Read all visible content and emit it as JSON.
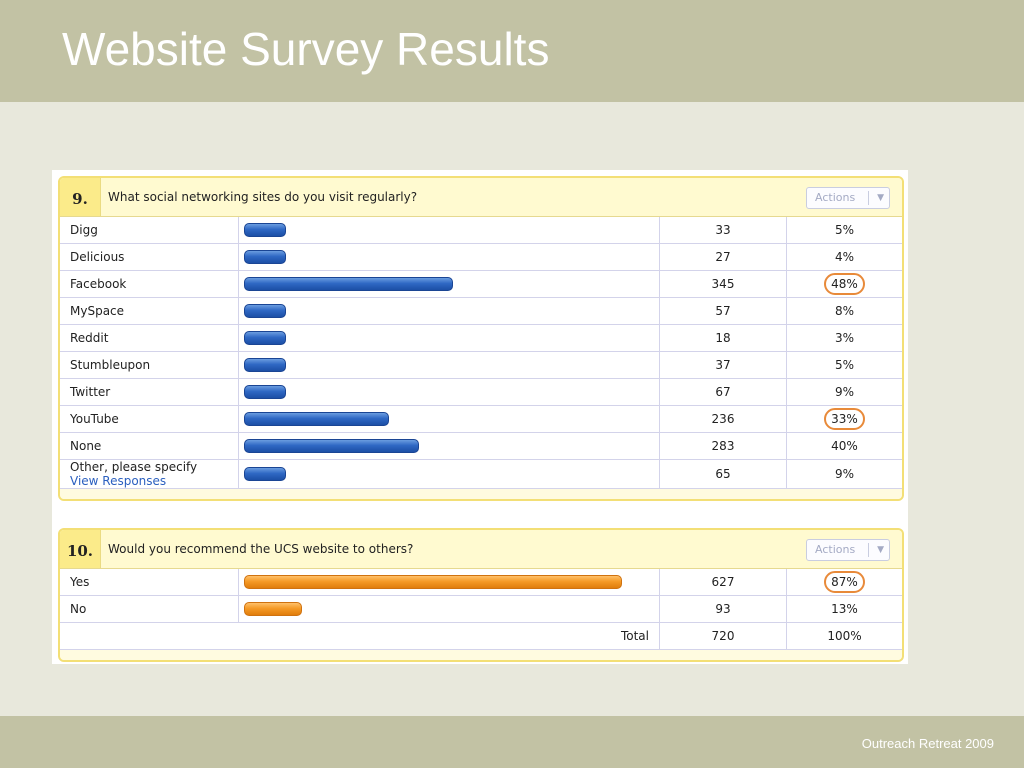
{
  "slide": {
    "title": "Website Survey Results",
    "footer": "Outreach Retreat 2009"
  },
  "colors": {
    "band": "#c2c2a4",
    "background": "#e8e8dc",
    "bar_blue": "#2f68c4",
    "bar_orange": "#f59a27",
    "highlight_circle": "#e88a3a"
  },
  "q9": {
    "number": "9.",
    "question": "What social networking sites do you visit regularly?",
    "actions_label": "Actions",
    "actions_icon": "chevron-down-icon",
    "rows": [
      {
        "label": "Digg",
        "count": "33",
        "percent": "5%",
        "fraction": 0.05,
        "highlighted": false
      },
      {
        "label": "Delicious",
        "count": "27",
        "percent": "4%",
        "fraction": 0.04,
        "highlighted": false
      },
      {
        "label": "Facebook",
        "count": "345",
        "percent": "48%",
        "fraction": 0.48,
        "highlighted": true
      },
      {
        "label": "MySpace",
        "count": "57",
        "percent": "8%",
        "fraction": 0.08,
        "highlighted": false
      },
      {
        "label": "Reddit",
        "count": "18",
        "percent": "3%",
        "fraction": 0.03,
        "highlighted": false
      },
      {
        "label": "Stumbleupon",
        "count": "37",
        "percent": "5%",
        "fraction": 0.05,
        "highlighted": false
      },
      {
        "label": "Twitter",
        "count": "67",
        "percent": "9%",
        "fraction": 0.09,
        "highlighted": false
      },
      {
        "label": "YouTube",
        "count": "236",
        "percent": "33%",
        "fraction": 0.33,
        "highlighted": true
      },
      {
        "label": "None",
        "count": "283",
        "percent": "40%",
        "fraction": 0.4,
        "highlighted": false
      }
    ],
    "other": {
      "label": "Other, please specify",
      "link": "View Responses",
      "count": "65",
      "percent": "9%",
      "fraction": 0.09,
      "highlighted": false
    }
  },
  "q10": {
    "number": "10.",
    "question": "Would you recommend the UCS website to others?",
    "actions_label": "Actions",
    "actions_icon": "chevron-down-icon",
    "rows": [
      {
        "label": "Yes",
        "count": "627",
        "percent": "87%",
        "fraction": 0.87,
        "highlighted": true
      },
      {
        "label": "No",
        "count": "93",
        "percent": "13%",
        "fraction": 0.13,
        "highlighted": false
      }
    ],
    "total": {
      "label": "Total",
      "count": "720",
      "percent": "100%"
    }
  }
}
